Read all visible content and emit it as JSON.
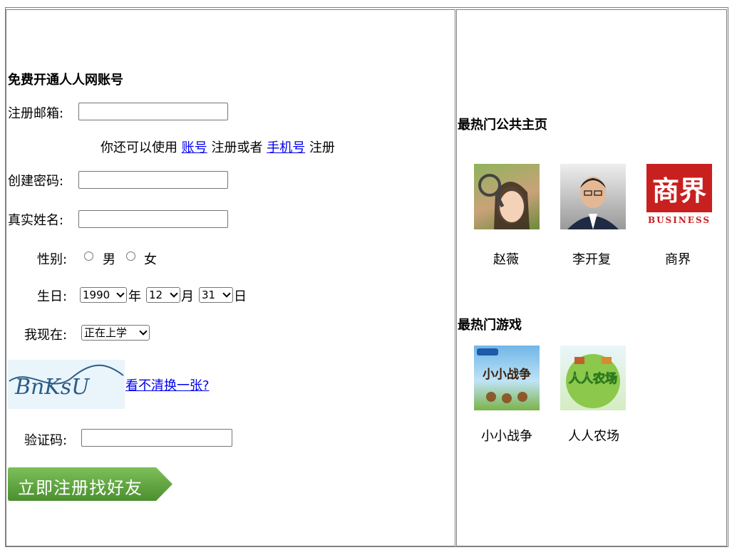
{
  "register": {
    "heading": "免费开通人人网账号",
    "email_label": "注册邮箱:",
    "alt_prefix": "你还可以使用",
    "alt_account_link": "账号",
    "alt_middle": "注册或者",
    "alt_phone_link": "手机号",
    "alt_suffix": "注册",
    "password_label": "创建密码:",
    "realname_label": "真实姓名:",
    "gender_label": "性别:",
    "gender_male": "男",
    "gender_female": "女",
    "birthday_label": "生日:",
    "year_value": "1990",
    "year_unit": "年",
    "month_value": "12",
    "month_unit": "月",
    "day_value": "31",
    "day_unit": "日",
    "status_label": "我现在:",
    "status_value": "正在上学",
    "captcha_text": "BnKsU",
    "captcha_refresh_link": "看不清换一张?",
    "verify_label": "验证码:",
    "submit_label": "立即注册找好友",
    "accent_color": "#5a9e3d"
  },
  "sidebar": {
    "pages_heading": "最热门公共主页",
    "pages": [
      {
        "label": "赵薇",
        "icon": "person-photo-icon"
      },
      {
        "label": "李开复",
        "icon": "person-photo-icon"
      },
      {
        "label": "商界",
        "icon": "business-logo-icon",
        "logo_text": "商界",
        "logo_sub": "BUSINESS"
      }
    ],
    "games_heading": "最热门游戏",
    "games": [
      {
        "label": "小小战争",
        "icon": "game-war-icon",
        "logo_text": "小小战争"
      },
      {
        "label": "人人农场",
        "icon": "game-farm-icon",
        "logo_text": "人人农场"
      }
    ]
  }
}
